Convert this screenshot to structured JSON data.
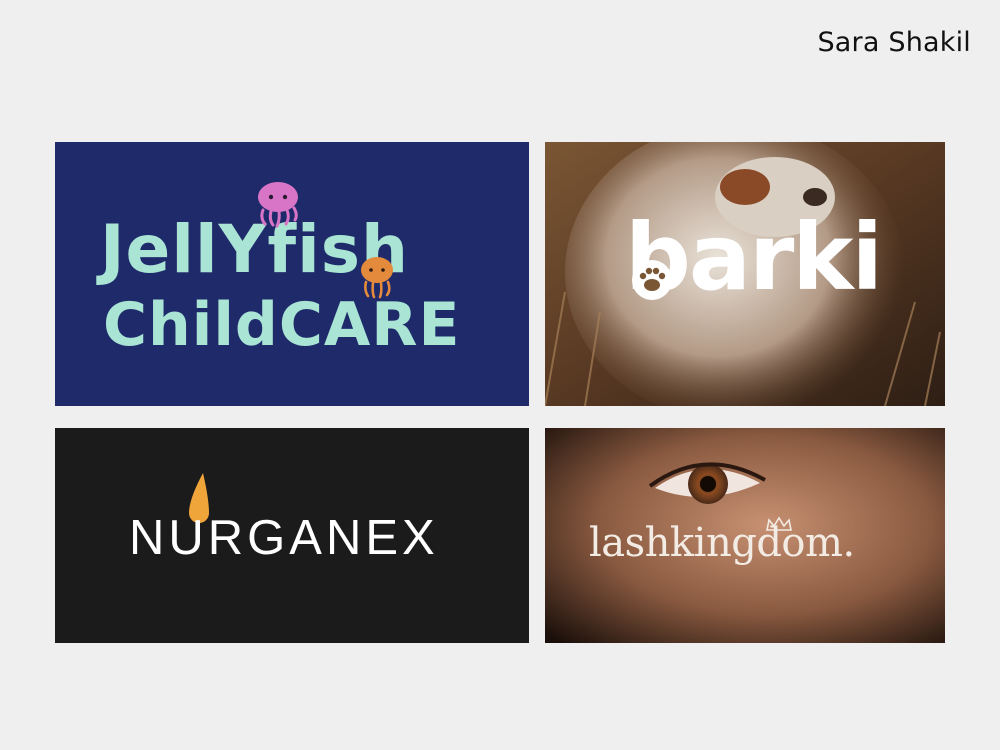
{
  "author": "Sara Shakil",
  "tiles": {
    "jellyfish": {
      "line1": "JellYfish",
      "line2": "ChildCARE",
      "bg_color": "#1f2a6b",
      "text_color": "#a9e4d4",
      "icons": [
        "jellyfish-pink-icon",
        "jellyfish-orange-icon"
      ]
    },
    "barki": {
      "word": "barki",
      "icon": "paw-icon"
    },
    "nurganex": {
      "word": "NURGANEX",
      "accent_color": "#f0a53a",
      "icon": "drop-icon"
    },
    "lashkingdom": {
      "word": "lashkingdom.",
      "icon": "crown-icon"
    }
  }
}
